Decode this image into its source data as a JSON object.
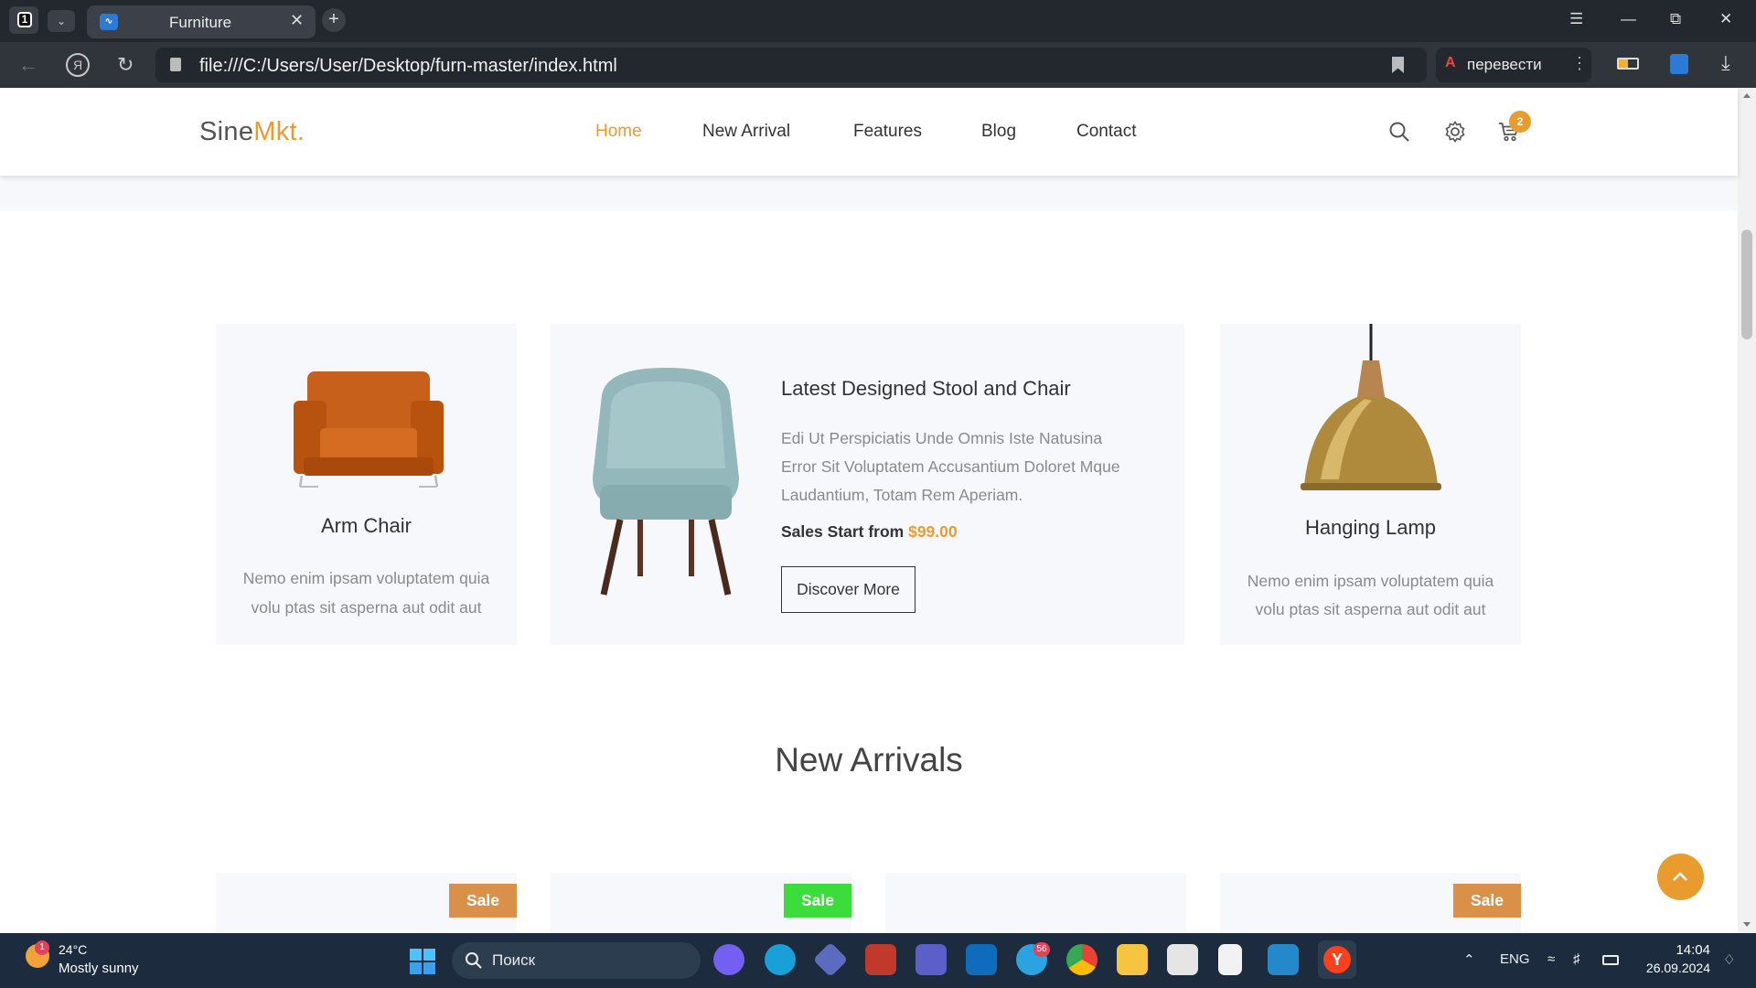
{
  "browser": {
    "tab_count": "1",
    "tab_title": "Furniture",
    "url": "file:///C:/Users/User/Desktop/furn-master/index.html",
    "translate_label": "перевести"
  },
  "site": {
    "logo_main": "Sine",
    "logo_accent": "Mkt",
    "logo_dot": ".",
    "nav": [
      {
        "label": "Home"
      },
      {
        "label": "New Arrival"
      },
      {
        "label": "Features"
      },
      {
        "label": "Blog"
      },
      {
        "label": "Contact"
      }
    ],
    "cart_count": "2",
    "colors": {
      "accent": "#e99c2e",
      "sale_orange": "#d9914a",
      "sale_green": "#3ddc3d",
      "card_bg": "#f7f8fb"
    }
  },
  "features": {
    "left": {
      "title": "Arm Chair",
      "desc_line1": "Nemo enim ipsam voluptatem quia",
      "desc_line2": "volu ptas sit asperna aut odit aut"
    },
    "middle": {
      "title": "Latest Designed Stool and Chair",
      "desc_line1": "Edi Ut Perspiciatis Unde Omnis Iste Natusina",
      "desc_line2": "Error Sit Voluptatem Accusantium Doloret Mque",
      "desc_line3": "Laudantium, Totam Rem Aperiam.",
      "price_label": "Sales Start from",
      "price": "$99.00",
      "button": "Discover More"
    },
    "right": {
      "title": "Hanging Lamp",
      "desc_line1": "Nemo enim ipsam voluptatem quia",
      "desc_line2": "volu ptas sit asperna aut odit aut"
    }
  },
  "arrivals": {
    "title": "New Arrivals",
    "badges": [
      "Sale",
      "Sale",
      "Sale"
    ]
  },
  "taskbar": {
    "weather_badge": "1",
    "temperature": "24°C",
    "weather": "Mostly sunny",
    "search_label": "Поиск",
    "telegram_badge": "56",
    "language": "ENG",
    "time": "14:04",
    "date": "26.09.2024"
  }
}
